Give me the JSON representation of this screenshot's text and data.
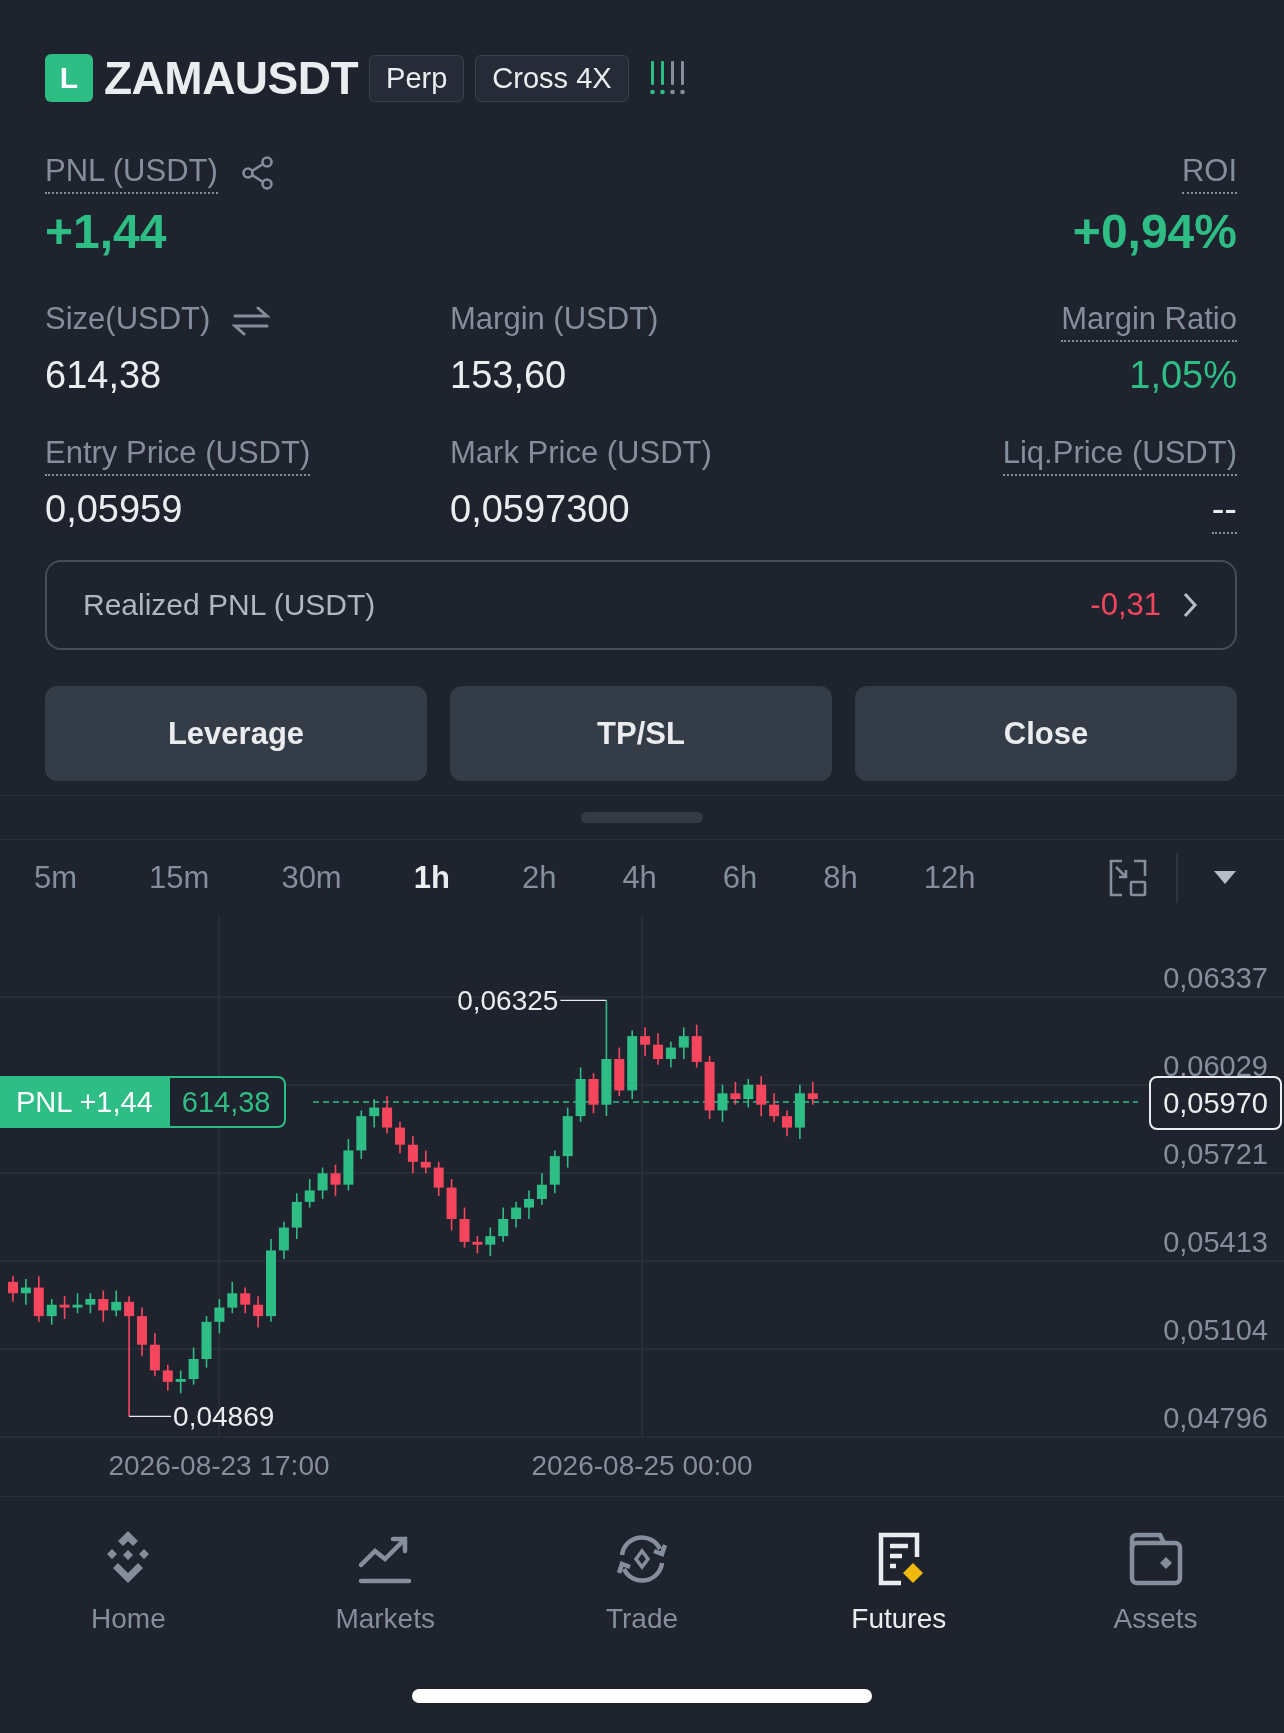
{
  "header": {
    "side_badge": "L",
    "symbol": "ZAMAUSDT",
    "tags": [
      "Perp",
      "Cross 4X"
    ]
  },
  "summary": [
    {
      "label": "PNL (USDT)",
      "value": "+1,44",
      "tooltip": true,
      "color": "#2ebd85"
    },
    {
      "label": "ROI",
      "value": "+0,94%",
      "tooltip": true,
      "color": "#2ebd85"
    }
  ],
  "stats": [
    {
      "label": "Size(USDT)",
      "value": "614,38",
      "tooltip": false,
      "color": "#eaecef"
    },
    {
      "label": "Margin (USDT)",
      "value": "153,60",
      "tooltip": false,
      "color": "#eaecef"
    },
    {
      "label": "Margin Ratio",
      "value": "1,05%",
      "tooltip": true,
      "color": "#2ebd85"
    },
    {
      "label": "Entry Price (USDT)",
      "value": "0,05959",
      "tooltip": true,
      "color": "#eaecef"
    },
    {
      "label": "Mark Price (USDT)",
      "value": "0,0597300",
      "tooltip": false,
      "color": "#eaecef"
    },
    {
      "label": "Liq.Price (USDT)",
      "value": "--",
      "tooltip": true,
      "color": "#eaecef"
    }
  ],
  "realized_pnl": {
    "label": "Realized PNL (USDT)",
    "value": "-0,31",
    "color": "#f6465d"
  },
  "actions": [
    "Leverage",
    "TP/SL",
    "Close"
  ],
  "timeframes": [
    {
      "label": "5m",
      "selected": false
    },
    {
      "label": "15m",
      "selected": false
    },
    {
      "label": "30m",
      "selected": false
    },
    {
      "label": "1h",
      "selected": true
    },
    {
      "label": "2h",
      "selected": false
    },
    {
      "label": "4h",
      "selected": false
    },
    {
      "label": "6h",
      "selected": false
    },
    {
      "label": "8h",
      "selected": false
    },
    {
      "label": "12h",
      "selected": false
    }
  ],
  "chart": {
    "price_labels": [
      "0,06337",
      "0,06029",
      "0,05721",
      "0,05413",
      "0,05104",
      "0,04796"
    ],
    "high_label": "0,06325",
    "low_label": "0,04869",
    "current_price": "0,05970",
    "position_tag": {
      "pnl": "PNL +1,44",
      "size": "614,38"
    },
    "dates": [
      "2026-08-23 17:00",
      "2026-08-25 00:00"
    ]
  },
  "nav": [
    {
      "label": "Home",
      "selected": false
    },
    {
      "label": "Markets",
      "selected": false
    },
    {
      "label": "Trade",
      "selected": false
    },
    {
      "label": "Futures",
      "selected": true
    },
    {
      "label": "Assets",
      "selected": false
    }
  ]
}
